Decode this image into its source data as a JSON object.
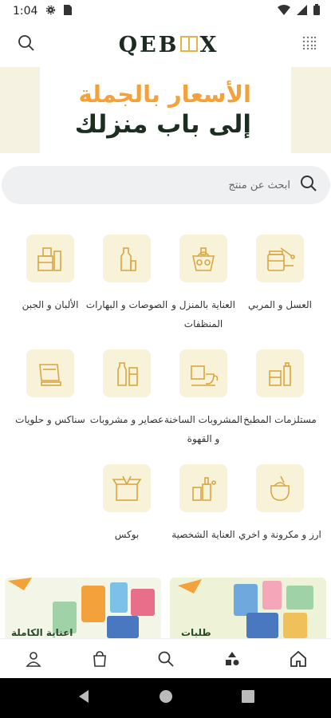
{
  "status": {
    "time": "1:04"
  },
  "header": {
    "logo": "QEB",
    "logo_end": "X"
  },
  "banner": {
    "line1": "الأسعار بالجملة",
    "line2": "إلى باب منزلك"
  },
  "search": {
    "placeholder": "ابحث عن منتج"
  },
  "categories": [
    {
      "label": "العسل و المربي",
      "icon": "honey-jar-icon"
    },
    {
      "label": "العناية بالمنزل و المنظفات",
      "icon": "cleaning-icon"
    },
    {
      "label": "الصوصات و البهارات",
      "icon": "sauce-bottle-icon"
    },
    {
      "label": "الألبان و الجبن",
      "icon": "dairy-icon"
    },
    {
      "label": "مستلزمات المطبخ",
      "icon": "kitchen-supplies-icon"
    },
    {
      "label": "المشروبات الساخنة و القهوة",
      "icon": "coffee-cup-icon"
    },
    {
      "label": "عصاير و مشروبات",
      "icon": "juice-icon"
    },
    {
      "label": "سناكس و حلويات",
      "icon": "snacks-icon"
    },
    {
      "label": "ارز و مكرونة و اخري",
      "icon": "rice-sack-icon"
    },
    {
      "label": "العناية الشخصية",
      "icon": "personal-care-icon"
    },
    {
      "label": "بوكس",
      "icon": "box-icon"
    }
  ],
  "promos": [
    {
      "caption": "طلبات"
    },
    {
      "caption": "اعناية الكاملة"
    }
  ],
  "colors": {
    "accent": "#f3a13b",
    "tile": "#f8f2d9",
    "brand_dark": "#1c2e20",
    "icon_stroke": "#d9a640"
  }
}
